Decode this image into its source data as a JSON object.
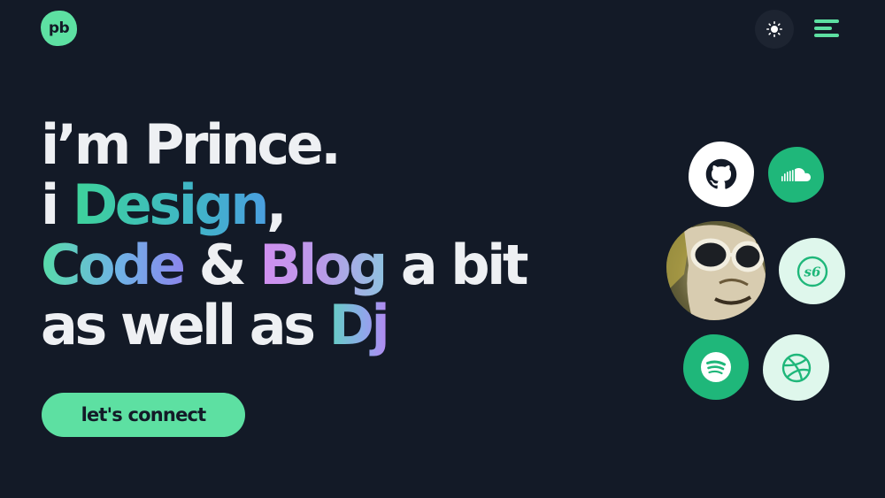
{
  "header": {
    "logo_text": "pb",
    "theme_toggle_icon": "sun-icon",
    "menu_icon": "hamburger-menu-icon"
  },
  "hero": {
    "line1": "i’m Prince.",
    "line2_prefix": "i ",
    "line2_highlight": "Design",
    "line2_suffix": ",",
    "line3_code": "Code",
    "line3_amp": " & ",
    "line3_blog": "Blog",
    "line3_suffix": " a bit",
    "line4_prefix": "as well as ",
    "line4_highlight": "Dj"
  },
  "cta": {
    "label": "let's connect"
  },
  "social": [
    {
      "name": "github-icon"
    },
    {
      "name": "soundcloud-icon"
    },
    {
      "name": "avatar"
    },
    {
      "name": "s6-icon",
      "label": "s6"
    },
    {
      "name": "spotify-icon"
    },
    {
      "name": "dribbble-icon"
    }
  ],
  "colors": {
    "background": "#131a27",
    "accent": "#5de0a2",
    "accent_dark": "#1fb77a",
    "accent_light": "#dff7ec"
  }
}
